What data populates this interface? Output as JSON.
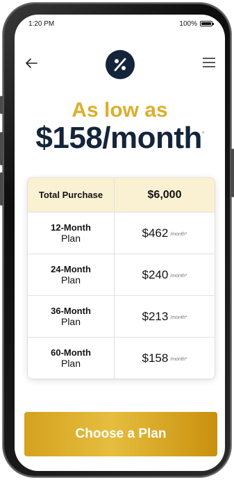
{
  "status": {
    "time": "1:20 PM",
    "battery": "100%"
  },
  "nav": {
    "back_icon": "arrow-left-icon",
    "logo_icon": "percent-icon",
    "menu_icon": "hamburger-icon"
  },
  "hero": {
    "tagline": "As low as",
    "price": "$158/month",
    "footnote_mark": "*"
  },
  "table": {
    "header": {
      "label": "Total Purchase",
      "value": "$6,000"
    },
    "rows": [
      {
        "term": "12-Month",
        "sub": "Plan",
        "amount": "$462",
        "per": "/month*"
      },
      {
        "term": "24-Month",
        "sub": "Plan",
        "amount": "$240",
        "per": "/month*"
      },
      {
        "term": "36-Month",
        "sub": "Plan",
        "amount": "$213",
        "per": "/month*"
      },
      {
        "term": "60-Month",
        "sub": "Plan",
        "amount": "$158",
        "per": "/month*"
      }
    ]
  },
  "cta": {
    "label": "Choose a Plan"
  },
  "colors": {
    "navy": "#14243a",
    "gold": "#dcae2a",
    "header_bg": "#faf1d3"
  }
}
